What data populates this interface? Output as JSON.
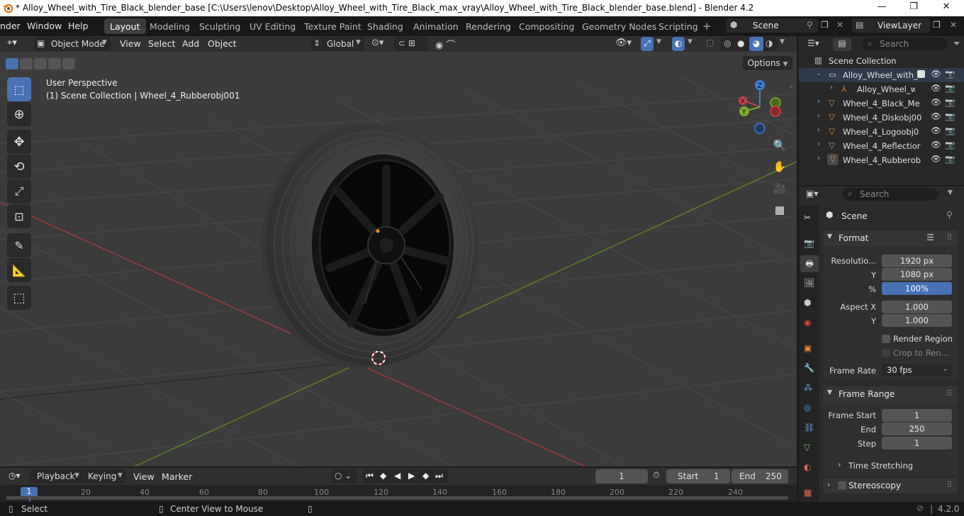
{
  "window": {
    "title": "* Alloy_Wheel_with_Tire_Black_blender_base [C:\\Users\\lenov\\Desktop\\Alloy_Wheel_with_Tire_Black_max_vray\\Alloy_Wheel_with_Tire_Black_blender_base.blend] - Blender 4.2",
    "minimize": "—",
    "maximize": "❐",
    "close": "✕"
  },
  "menus": [
    "nder",
    "Window",
    "Help"
  ],
  "workspaces": [
    "Layout",
    "Modeling",
    "Sculpting",
    "UV Editing",
    "Texture Paint",
    "Shading",
    "Animation",
    "Rendering",
    "Compositing",
    "Geometry Nodes",
    "Scripting"
  ],
  "active_workspace": "Layout",
  "scene_name": "Scene",
  "view_layer": "ViewLayer",
  "viewport_header": {
    "mode": "Object Mode",
    "menus": [
      "View",
      "Select",
      "Add",
      "Object"
    ],
    "transform_orientation": "Global",
    "options": "Options"
  },
  "viewport": {
    "perspective_label": "User Perspective",
    "collection_label": "(1) Scene Collection | Wheel_4_Rubberobj001",
    "gizmo_axes": [
      "X",
      "Y",
      "Z"
    ]
  },
  "outliner": {
    "search_placeholder": "Search",
    "root": "Scene Collection",
    "items": [
      {
        "label": "Alloy_Wheel_with_T",
        "type": "collection"
      },
      {
        "label": "Alloy_Wheel_wi",
        "type": "armature"
      },
      {
        "label": "Wheel_4_Black_Me",
        "type": "mesh"
      },
      {
        "label": "Wheel_4_Diskobj00",
        "type": "mesh"
      },
      {
        "label": "Wheel_4_Logoobj0",
        "type": "mesh"
      },
      {
        "label": "Wheel_4_Reflectior",
        "type": "mesh"
      },
      {
        "label": "Wheel_4_Rubberob",
        "type": "mesh"
      }
    ]
  },
  "properties": {
    "search_placeholder": "Search",
    "context": "Scene",
    "format_panel": "Format",
    "resolution_x_label": "Resolutio...",
    "resolution_x": "1920 px",
    "resolution_y_label": "Y",
    "resolution_y": "1080 px",
    "percent_label": "%",
    "percent": "100%",
    "aspect_x_label": "Aspect X",
    "aspect_x": "1.000",
    "aspect_y_label": "Y",
    "aspect_y": "1.000",
    "render_region": "Render Region",
    "crop": "Crop to Ren...",
    "frame_rate_label": "Frame Rate",
    "frame_rate": "30 fps",
    "frame_range_panel": "Frame Range",
    "frame_start_label": "Frame Start",
    "frame_start": "1",
    "end_label": "End",
    "end": "250",
    "step_label": "Step",
    "step": "1",
    "time_stretching": "Time Stretching",
    "stereoscopy": "Stereoscopy"
  },
  "timeline": {
    "menus": [
      "Playback",
      "Keying",
      "View",
      "Marker"
    ],
    "current_frame": "1",
    "start_label": "Start",
    "start": "1",
    "end_label": "End",
    "end": "250",
    "ruler": [
      "1",
      "20",
      "40",
      "60",
      "80",
      "100",
      "120",
      "140",
      "160",
      "180",
      "200",
      "220",
      "240"
    ]
  },
  "status": {
    "select": "Select",
    "center_view": "Center View to Mouse",
    "version": "4.2.0"
  },
  "colors": {
    "accent": "#4772b3",
    "x_axis": "#d0404a",
    "y_axis": "#7dab2a",
    "z_axis": "#3c7fd4",
    "mesh_icon": "#e68b3c"
  }
}
